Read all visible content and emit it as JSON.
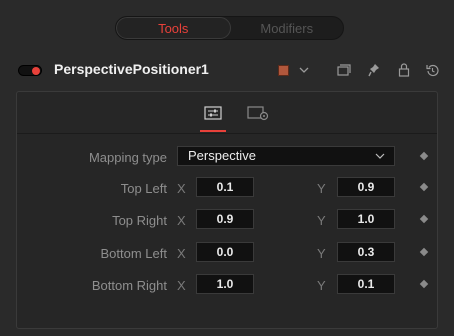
{
  "tabs": {
    "tools": "Tools",
    "modifiers": "Modifiers"
  },
  "node": {
    "title": "PerspectivePositioner1",
    "swatch_color": "#b0573c",
    "toggle_color": "#e8413a"
  },
  "header_icons": [
    "swatch-dropdown",
    "window-icon",
    "pin-icon",
    "lock-icon",
    "reset-icon"
  ],
  "controls": {
    "mapping_type": {
      "label": "Mapping type",
      "value": "Perspective"
    },
    "top_left": {
      "label": "Top Left",
      "x_label": "X",
      "y_label": "Y",
      "x": "0.1",
      "y": "0.9"
    },
    "top_right": {
      "label": "Top Right",
      "x_label": "X",
      "y_label": "Y",
      "x": "0.9",
      "y": "1.0"
    },
    "bottom_left": {
      "label": "Bottom Left",
      "x_label": "X",
      "y_label": "Y",
      "x": "0.0",
      "y": "0.3"
    },
    "bottom_right": {
      "label": "Bottom Right",
      "x_label": "X",
      "y_label": "Y",
      "x": "1.0",
      "y": "0.1"
    }
  }
}
